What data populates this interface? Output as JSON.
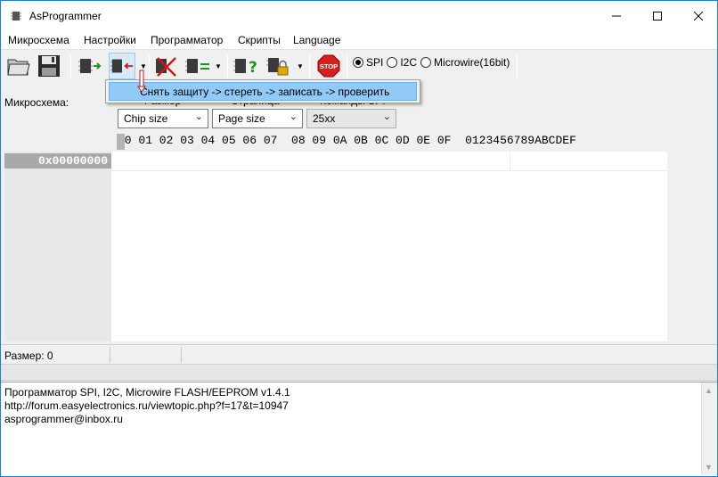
{
  "window": {
    "title": "AsProgrammer"
  },
  "menu": {
    "items": [
      "Микросхема",
      "Настройки",
      "Программатор",
      "Скрипты",
      "Language"
    ]
  },
  "toolbar": {
    "protocols": [
      {
        "label": "SPI",
        "checked": true
      },
      {
        "label": "I2C",
        "checked": false
      },
      {
        "label": "Microwire(16bit)",
        "checked": false
      }
    ],
    "stop_label": "STOP"
  },
  "popup": {
    "item": "Снять защиту -> стереть -> записать -> проверить"
  },
  "settings": {
    "chip_label": "Микросхема:",
    "size_label": "Размер",
    "page_label": "Страница",
    "spi_cmd_label": "Команды SPI",
    "size_value": "Chip size",
    "page_value": "Page size",
    "spi_cmd_value": "25xx"
  },
  "hex": {
    "header": "00 01 02 03 04 05 06 07  08 09 0A 0B 0C 0D 0E 0F  0123456789ABCDEF",
    "address": "0x00000000"
  },
  "status": {
    "size": "Размер: 0"
  },
  "log": {
    "lines": [
      "Программатор SPI, I2C, Microwire FLASH/EEPROM v1.4.1",
      "http://forum.easyelectronics.ru/viewtopic.php?f=17&t=10947",
      "asprogrammer@inbox.ru"
    ]
  },
  "colors": {
    "highlight": "#91c9f7",
    "address_bg": "#a9a9a9",
    "border_accent": "#1883d7"
  }
}
